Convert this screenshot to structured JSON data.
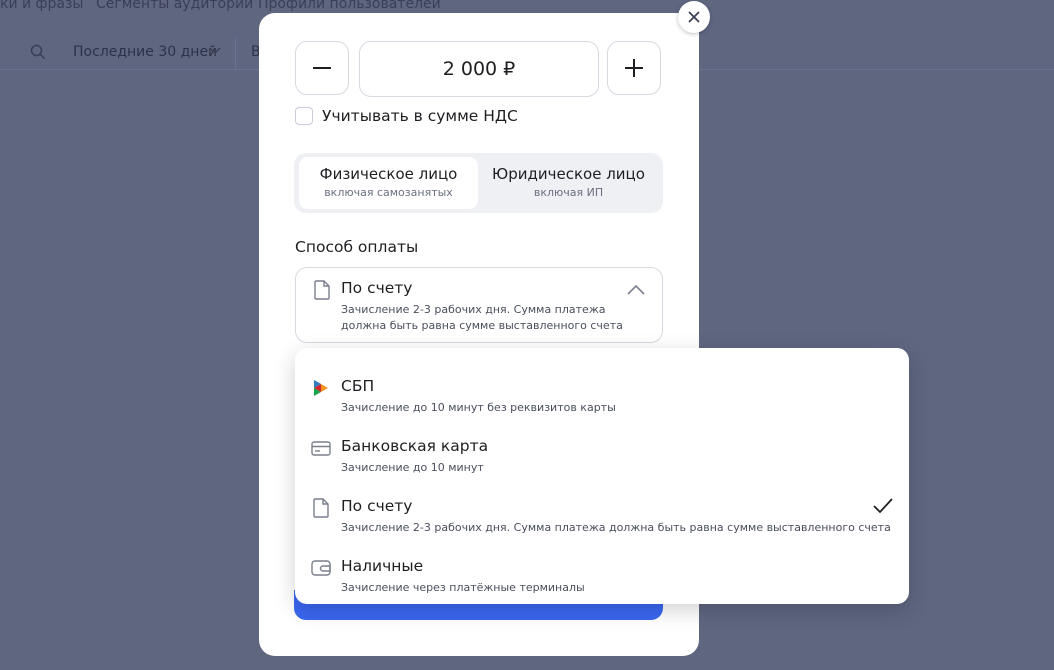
{
  "background": {
    "tabs": [
      "ки и фразы",
      "Сегменты аудитории",
      "Профили пользователей"
    ],
    "period": "Последние 30 дней",
    "extra": "В"
  },
  "amount": {
    "value": "2 000 ₽",
    "minus": "−",
    "plus": "+"
  },
  "vat": {
    "label": "Учитывать в сумме НДС",
    "checked": false
  },
  "payer_type": [
    {
      "title": "Физическое лицо",
      "subtitle": "включая самозанятых",
      "active": true
    },
    {
      "title": "Юридическое лицо",
      "subtitle": "включая ИП",
      "active": false
    }
  ],
  "payment": {
    "title": "Способ оплаты",
    "selected": {
      "name": "По счету",
      "desc": "Зачисление 2-3 рабочих дня. Сумма платежа должна быть равна сумме выставленного счета"
    },
    "options": [
      {
        "name": "СБП",
        "desc": "Зачисление до 10 минут без реквизитов карты",
        "icon": "sbp-icon",
        "selected": false
      },
      {
        "name": "Банковская карта",
        "desc": "Зачисление до 10 минут",
        "icon": "bank-card-icon",
        "selected": false
      },
      {
        "name": "По счету",
        "desc": "Зачисление 2-3 рабочих дня. Сумма платежа должна быть равна сумме выставленного счета",
        "icon": "document-icon",
        "selected": true
      },
      {
        "name": "Наличные",
        "desc": "Зачисление через платёжные терминалы",
        "icon": "wallet-icon",
        "selected": false
      }
    ]
  },
  "colors": {
    "accent": "#3a67f0",
    "overlay": "#5f6680"
  }
}
